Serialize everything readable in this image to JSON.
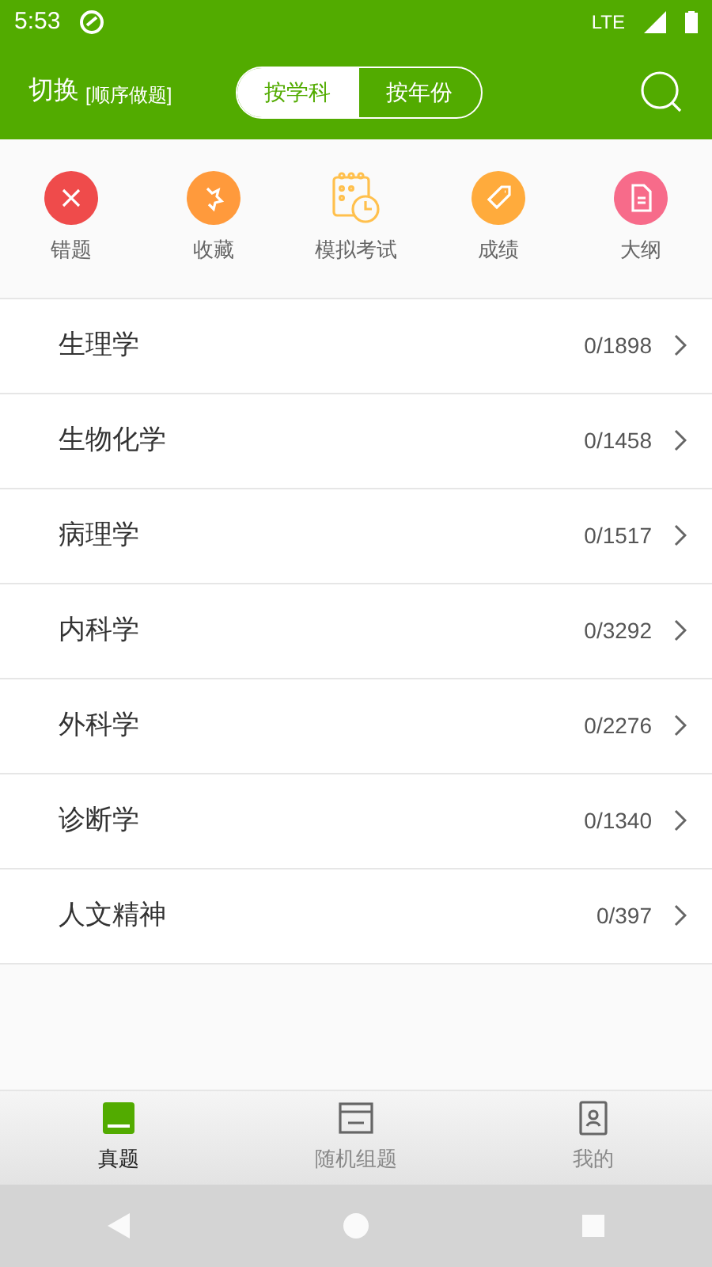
{
  "status_bar": {
    "time": "5:53",
    "network": "LTE"
  },
  "header": {
    "title": "切换",
    "subtitle": "[顺序做题]",
    "segments": [
      {
        "label": "按学科",
        "selected": true
      },
      {
        "label": "按年份",
        "selected": false
      }
    ]
  },
  "shortcuts": [
    {
      "label": "错题",
      "kind": "wrong",
      "color": "#ef4b4b"
    },
    {
      "label": "收藏",
      "kind": "favorite",
      "color": "#ff9a3c"
    },
    {
      "label": "模拟考试",
      "kind": "exam",
      "color": "#ffc04d"
    },
    {
      "label": "成绩",
      "kind": "score",
      "color": "#ffab3c"
    },
    {
      "label": "大纲",
      "kind": "outline",
      "color": "#f76b8a"
    }
  ],
  "subjects": [
    {
      "name": "生理学",
      "count": "0/1898"
    },
    {
      "name": "生物化学",
      "count": "0/1458"
    },
    {
      "name": "病理学",
      "count": "0/1517"
    },
    {
      "name": "内科学",
      "count": "0/3292"
    },
    {
      "name": "外科学",
      "count": "0/2276"
    },
    {
      "name": "诊断学",
      "count": "0/1340"
    },
    {
      "name": "人文精神",
      "count": "0/397"
    }
  ],
  "bottom_nav": [
    {
      "label": "真题",
      "kind": "book",
      "selected": true
    },
    {
      "label": "随机组题",
      "kind": "random",
      "selected": false
    },
    {
      "label": "我的",
      "kind": "profile",
      "selected": false
    }
  ]
}
